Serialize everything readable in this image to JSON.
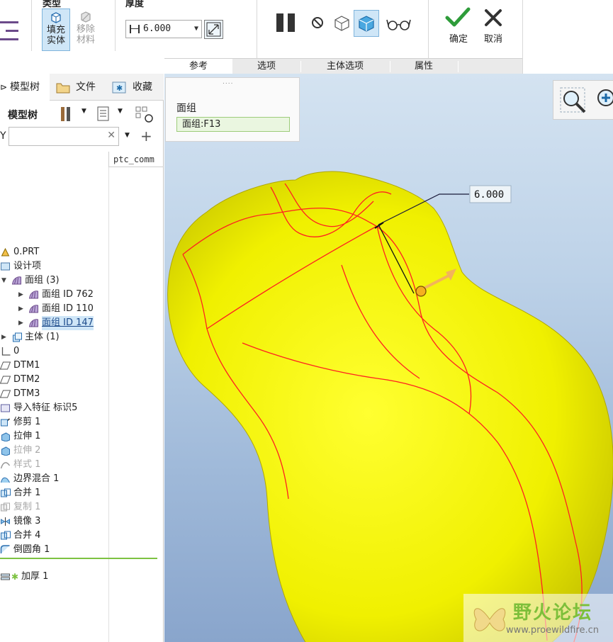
{
  "ribbon": {
    "group_type_title": "类型",
    "fill_solid_label": "填充\n实体",
    "fill_solid_line1": "填充",
    "fill_solid_line2": "实体",
    "remove_material_line1": "移除",
    "remove_material_line2": "材料",
    "group_thickness_title": "厚度",
    "thickness_value": "6.000",
    "ok_label": "确定",
    "cancel_label": "取消",
    "tabs": [
      "参考",
      "选项",
      "主体选项",
      "属性"
    ]
  },
  "panel": {
    "tabs": [
      "模型树",
      "文件",
      "收藏"
    ],
    "tree_title": "模型树",
    "column_header": "ptc_comm",
    "filter_value": ""
  },
  "tree": {
    "items": [
      {
        "label": "0.PRT",
        "dim": false
      },
      {
        "label": "设计项",
        "dim": false
      },
      {
        "label": "面组 (3)",
        "dim": false
      },
      {
        "label": "面组 ID 762",
        "dim": false
      },
      {
        "label": "面组 ID 110",
        "dim": false
      },
      {
        "label": "面组 ID 147",
        "dim": false
      },
      {
        "label": "主体 (1)",
        "dim": false
      },
      {
        "label": "0",
        "dim": false
      },
      {
        "label": "DTM1",
        "dim": false
      },
      {
        "label": "DTM2",
        "dim": false
      },
      {
        "label": "DTM3",
        "dim": false
      },
      {
        "label": "导入特征 标识5",
        "dim": false
      },
      {
        "label": "修剪 1",
        "dim": false
      },
      {
        "label": "拉伸 1",
        "dim": false
      },
      {
        "label": "拉伸 2",
        "dim": true
      },
      {
        "label": "样式 1",
        "dim": true
      },
      {
        "label": "边界混合 1",
        "dim": false
      },
      {
        "label": "合并 1",
        "dim": false
      },
      {
        "label": "复制 1",
        "dim": true
      },
      {
        "label": "镜像 3",
        "dim": false
      },
      {
        "label": "合并 4",
        "dim": false
      },
      {
        "label": "倒圆角 1",
        "dim": false
      },
      {
        "label": "加厚 1",
        "dim": false
      }
    ]
  },
  "references": {
    "label": "面组",
    "value": "面组:F13"
  },
  "model": {
    "dimension_value": "6.000"
  },
  "watermark": {
    "title": "野火论坛",
    "url": "www.proewildfire.cn"
  },
  "colors": {
    "solid": "#f5f500",
    "edges": "#ff2020",
    "accent": "#7fb4dc",
    "ok_green": "#2e9c3a"
  }
}
